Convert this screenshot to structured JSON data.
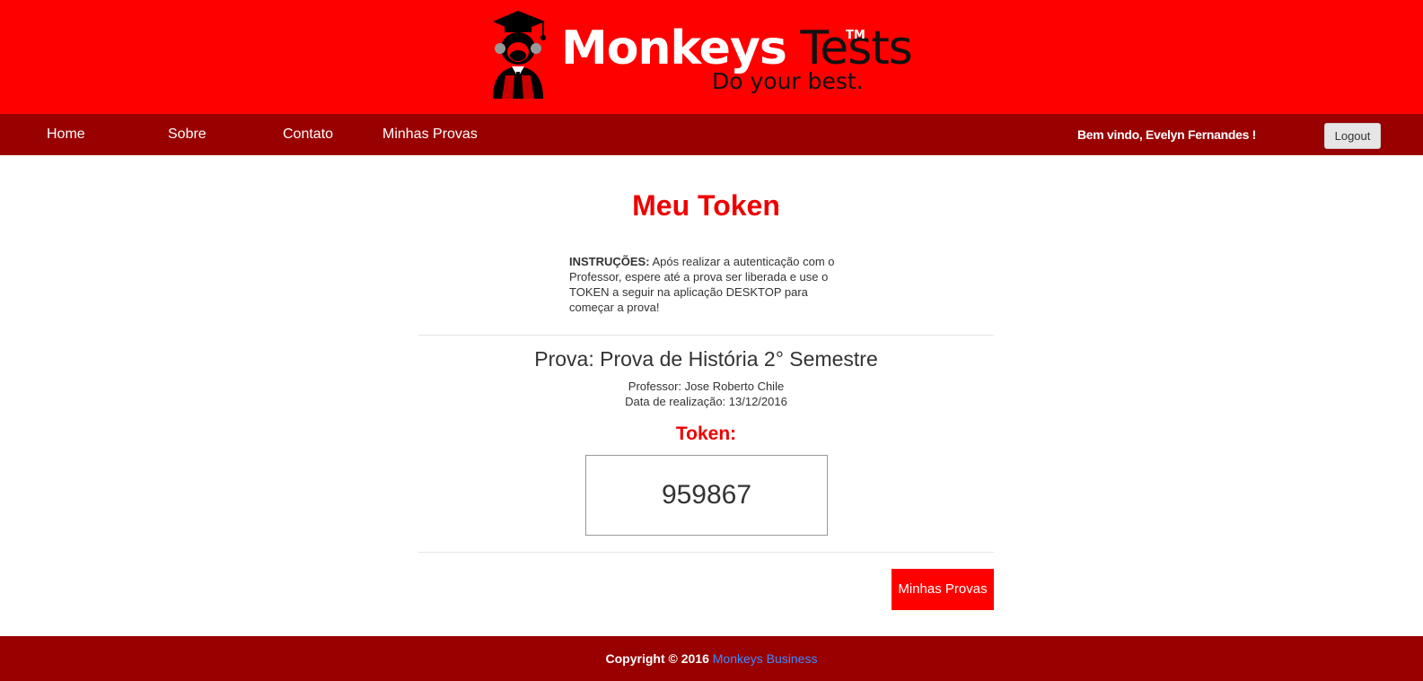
{
  "header": {
    "brand_primary": "Monkeys",
    "brand_secondary": "Tests",
    "trademark": "TM",
    "tagline": "Do your best.",
    "colors": {
      "header_bg": "#ff0000",
      "navbar_bg": "#990000",
      "accent": "#ee0000"
    }
  },
  "nav": {
    "items": [
      {
        "label": "Home"
      },
      {
        "label": "Sobre"
      },
      {
        "label": "Contato"
      },
      {
        "label": "Minhas Provas"
      }
    ],
    "welcome": "Bem vindo, Evelyn Fernandes !",
    "logout_label": "Logout"
  },
  "main": {
    "title": "Meu Token",
    "instructions_label": "INSTRUÇÕES:",
    "instructions_text": " Após realizar a autenticação com o Professor, espere até a prova ser liberada e use o TOKEN a seguir na aplicação DESKTOP para começar a prova!",
    "exam_title": "Prova: Prova de História 2° Semestre",
    "professor": "Professor: Jose Roberto Chile",
    "date": "Data de realização: 13/12/2016",
    "token_label": "Token:",
    "token_value": "959867",
    "minhas_provas_button": "Minhas Provas"
  },
  "footer": {
    "copyright": "Copyright © 2016",
    "link_text": "Monkeys Business"
  }
}
